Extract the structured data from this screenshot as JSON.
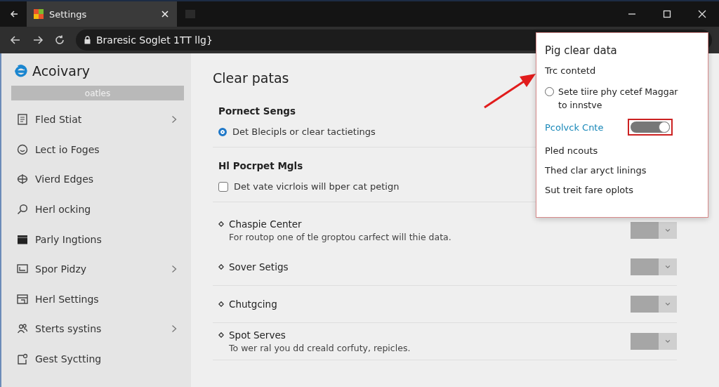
{
  "window": {
    "tab_title": "Settings",
    "address": "Braresic Soglet 1TT llg}"
  },
  "sidebar": {
    "title": "Acoivary",
    "button": "oatles",
    "items": [
      {
        "label": "Fled Stiat",
        "has_children": true
      },
      {
        "label": "Lect io Foges",
        "has_children": false
      },
      {
        "label": "Vierd Edges",
        "has_children": false
      },
      {
        "label": "Herl ocking",
        "has_children": false
      },
      {
        "label": "Parly Ingtions",
        "has_children": false
      },
      {
        "label": "Spor Pidzy",
        "has_children": true
      },
      {
        "label": "Herl Settings",
        "has_children": false
      },
      {
        "label": "Sterts systins",
        "has_children": true
      },
      {
        "label": "Gest Syctting",
        "has_children": false
      }
    ]
  },
  "main": {
    "title": "Clear patas",
    "groups": [
      {
        "heading": "Pornect Sengs",
        "option": {
          "kind": "radio",
          "label": "Det Blecipls or clear tactietings",
          "checked": true
        }
      },
      {
        "heading": "Hl Pocrpet Mgls",
        "option": {
          "kind": "checkbox",
          "label": "Det vate vicrlois will bper cat petign",
          "checked": false
        }
      }
    ],
    "rows": [
      {
        "title": "Chaspie Center",
        "description": "For routop one of tle groptou carfect will thie data."
      },
      {
        "title": "Sover Setigs"
      },
      {
        "title": "Chutgcing"
      },
      {
        "title": "Spot Serves",
        "description": "To wer ral you dd creald corfuty, repicles."
      }
    ]
  },
  "popup": {
    "title": "Pig clear data",
    "subtitle": "Trc contetd",
    "radio": {
      "label": "Sete tiire phy cetef Maggar to innstve",
      "checked": false
    },
    "toggle": {
      "label": "Pcolvck Cnte",
      "on": true
    },
    "items": [
      "Pled ncouts",
      "Thed clar aryct linings",
      "Sut treit fare oplots"
    ]
  }
}
